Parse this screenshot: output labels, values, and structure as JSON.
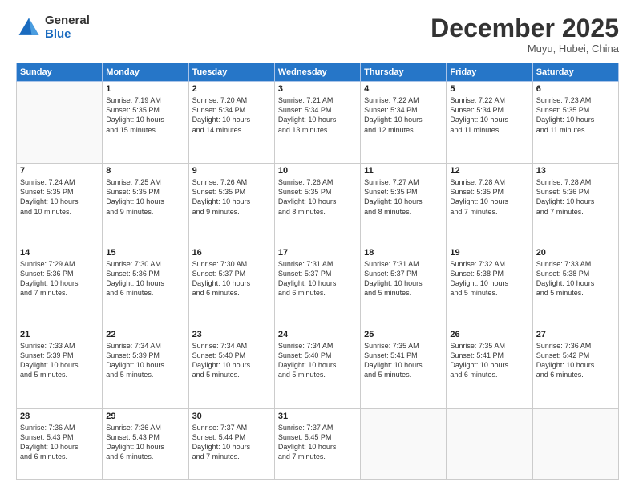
{
  "header": {
    "logo_general": "General",
    "logo_blue": "Blue",
    "month_title": "December 2025",
    "subtitle": "Muyu, Hubei, China"
  },
  "days_of_week": [
    "Sunday",
    "Monday",
    "Tuesday",
    "Wednesday",
    "Thursday",
    "Friday",
    "Saturday"
  ],
  "weeks": [
    [
      {
        "day": "",
        "info": ""
      },
      {
        "day": "1",
        "info": "Sunrise: 7:19 AM\nSunset: 5:35 PM\nDaylight: 10 hours\nand 15 minutes."
      },
      {
        "day": "2",
        "info": "Sunrise: 7:20 AM\nSunset: 5:34 PM\nDaylight: 10 hours\nand 14 minutes."
      },
      {
        "day": "3",
        "info": "Sunrise: 7:21 AM\nSunset: 5:34 PM\nDaylight: 10 hours\nand 13 minutes."
      },
      {
        "day": "4",
        "info": "Sunrise: 7:22 AM\nSunset: 5:34 PM\nDaylight: 10 hours\nand 12 minutes."
      },
      {
        "day": "5",
        "info": "Sunrise: 7:22 AM\nSunset: 5:34 PM\nDaylight: 10 hours\nand 11 minutes."
      },
      {
        "day": "6",
        "info": "Sunrise: 7:23 AM\nSunset: 5:35 PM\nDaylight: 10 hours\nand 11 minutes."
      }
    ],
    [
      {
        "day": "7",
        "info": "Sunrise: 7:24 AM\nSunset: 5:35 PM\nDaylight: 10 hours\nand 10 minutes."
      },
      {
        "day": "8",
        "info": "Sunrise: 7:25 AM\nSunset: 5:35 PM\nDaylight: 10 hours\nand 9 minutes."
      },
      {
        "day": "9",
        "info": "Sunrise: 7:26 AM\nSunset: 5:35 PM\nDaylight: 10 hours\nand 9 minutes."
      },
      {
        "day": "10",
        "info": "Sunrise: 7:26 AM\nSunset: 5:35 PM\nDaylight: 10 hours\nand 8 minutes."
      },
      {
        "day": "11",
        "info": "Sunrise: 7:27 AM\nSunset: 5:35 PM\nDaylight: 10 hours\nand 8 minutes."
      },
      {
        "day": "12",
        "info": "Sunrise: 7:28 AM\nSunset: 5:35 PM\nDaylight: 10 hours\nand 7 minutes."
      },
      {
        "day": "13",
        "info": "Sunrise: 7:28 AM\nSunset: 5:36 PM\nDaylight: 10 hours\nand 7 minutes."
      }
    ],
    [
      {
        "day": "14",
        "info": "Sunrise: 7:29 AM\nSunset: 5:36 PM\nDaylight: 10 hours\nand 7 minutes."
      },
      {
        "day": "15",
        "info": "Sunrise: 7:30 AM\nSunset: 5:36 PM\nDaylight: 10 hours\nand 6 minutes."
      },
      {
        "day": "16",
        "info": "Sunrise: 7:30 AM\nSunset: 5:37 PM\nDaylight: 10 hours\nand 6 minutes."
      },
      {
        "day": "17",
        "info": "Sunrise: 7:31 AM\nSunset: 5:37 PM\nDaylight: 10 hours\nand 6 minutes."
      },
      {
        "day": "18",
        "info": "Sunrise: 7:31 AM\nSunset: 5:37 PM\nDaylight: 10 hours\nand 5 minutes."
      },
      {
        "day": "19",
        "info": "Sunrise: 7:32 AM\nSunset: 5:38 PM\nDaylight: 10 hours\nand 5 minutes."
      },
      {
        "day": "20",
        "info": "Sunrise: 7:33 AM\nSunset: 5:38 PM\nDaylight: 10 hours\nand 5 minutes."
      }
    ],
    [
      {
        "day": "21",
        "info": "Sunrise: 7:33 AM\nSunset: 5:39 PM\nDaylight: 10 hours\nand 5 minutes."
      },
      {
        "day": "22",
        "info": "Sunrise: 7:34 AM\nSunset: 5:39 PM\nDaylight: 10 hours\nand 5 minutes."
      },
      {
        "day": "23",
        "info": "Sunrise: 7:34 AM\nSunset: 5:40 PM\nDaylight: 10 hours\nand 5 minutes."
      },
      {
        "day": "24",
        "info": "Sunrise: 7:34 AM\nSunset: 5:40 PM\nDaylight: 10 hours\nand 5 minutes."
      },
      {
        "day": "25",
        "info": "Sunrise: 7:35 AM\nSunset: 5:41 PM\nDaylight: 10 hours\nand 5 minutes."
      },
      {
        "day": "26",
        "info": "Sunrise: 7:35 AM\nSunset: 5:41 PM\nDaylight: 10 hours\nand 6 minutes."
      },
      {
        "day": "27",
        "info": "Sunrise: 7:36 AM\nSunset: 5:42 PM\nDaylight: 10 hours\nand 6 minutes."
      }
    ],
    [
      {
        "day": "28",
        "info": "Sunrise: 7:36 AM\nSunset: 5:43 PM\nDaylight: 10 hours\nand 6 minutes."
      },
      {
        "day": "29",
        "info": "Sunrise: 7:36 AM\nSunset: 5:43 PM\nDaylight: 10 hours\nand 6 minutes."
      },
      {
        "day": "30",
        "info": "Sunrise: 7:37 AM\nSunset: 5:44 PM\nDaylight: 10 hours\nand 7 minutes."
      },
      {
        "day": "31",
        "info": "Sunrise: 7:37 AM\nSunset: 5:45 PM\nDaylight: 10 hours\nand 7 minutes."
      },
      {
        "day": "",
        "info": ""
      },
      {
        "day": "",
        "info": ""
      },
      {
        "day": "",
        "info": ""
      }
    ]
  ]
}
